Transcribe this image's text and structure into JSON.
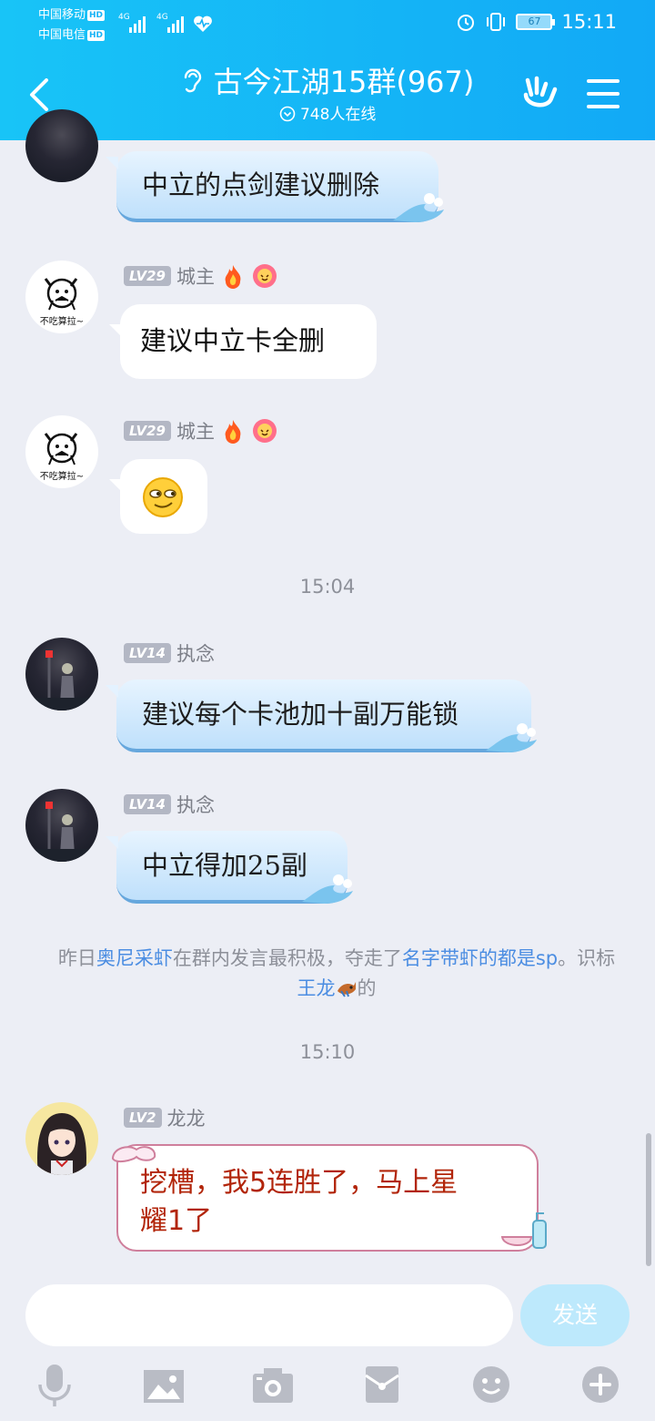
{
  "status": {
    "carrier1": "中国移动",
    "carrier2": "中国电信",
    "hd": "HD",
    "network": "4G",
    "battery": "67",
    "time": "15:11"
  },
  "header": {
    "title": "古今江湖15群(967)",
    "online": "748人在线"
  },
  "messages": [
    {
      "text": "中立的点剑建议删除"
    },
    {
      "level": "LV29",
      "name": "城主",
      "text": "建议中立卡全删",
      "avatar_text": "不吃算拉~"
    },
    {
      "level": "LV29",
      "name": "城主",
      "avatar_text": "不吃算拉~"
    },
    {
      "level": "LV14",
      "name": "执念",
      "text": "建议每个卡池加十副万能锁"
    },
    {
      "level": "LV14",
      "name": "执念",
      "text": "中立得加25副"
    },
    {
      "level": "LV2",
      "name": "龙龙",
      "text_line1": "挖槽，我5连胜了，马上星",
      "text_line2": "耀1了"
    }
  ],
  "times": [
    "15:04",
    "15:10"
  ],
  "system_notice": {
    "p1": "昨日",
    "user": "奥尼采虾",
    "p2": "在群内发言最积极，夺走了",
    "badge": "名字带虾的都是sp",
    "p3": "。识标",
    "badge2": "王龙",
    "p4": "的"
  },
  "input": {
    "placeholder": "",
    "send_label": "发送"
  },
  "colors": {
    "header": "#18b3f6",
    "link": "#4b8de2",
    "pink_text": "#b2250a"
  },
  "icons": [
    "back-icon",
    "ear-icon",
    "gesture-icon",
    "menu-icon",
    "mic-icon",
    "image-icon",
    "camera-icon",
    "redpacket-icon",
    "emoji-icon",
    "plus-icon"
  ]
}
